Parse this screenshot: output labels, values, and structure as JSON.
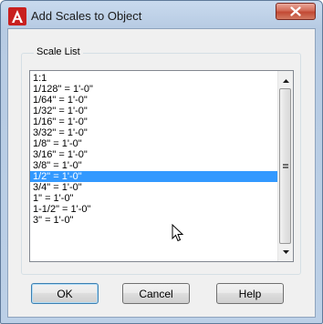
{
  "window": {
    "title": "Add Scales to Object",
    "close_glyph": "X",
    "app_icon": "autocad-app-icon",
    "colors": {
      "selection": "#3399ff",
      "close_button": "#c24934"
    }
  },
  "scale_list": {
    "label": "Scale List",
    "items": [
      "1:1",
      "1/128\" = 1'-0\"",
      "1/64\" = 1'-0\"",
      "1/32\" = 1'-0\"",
      "1/16\" = 1'-0\"",
      "3/32\" = 1'-0\"",
      "1/8\" = 1'-0\"",
      "3/16\" = 1'-0\"",
      "3/8\" = 1'-0\"",
      "1/2\" = 1'-0\"",
      "3/4\" = 1'-0\"",
      "1\" = 1'-0\"",
      "1-1/2\" = 1'-0\"",
      "3\" = 1'-0\""
    ],
    "selected_index": 9
  },
  "buttons": {
    "ok": "OK",
    "cancel": "Cancel",
    "help": "Help"
  }
}
